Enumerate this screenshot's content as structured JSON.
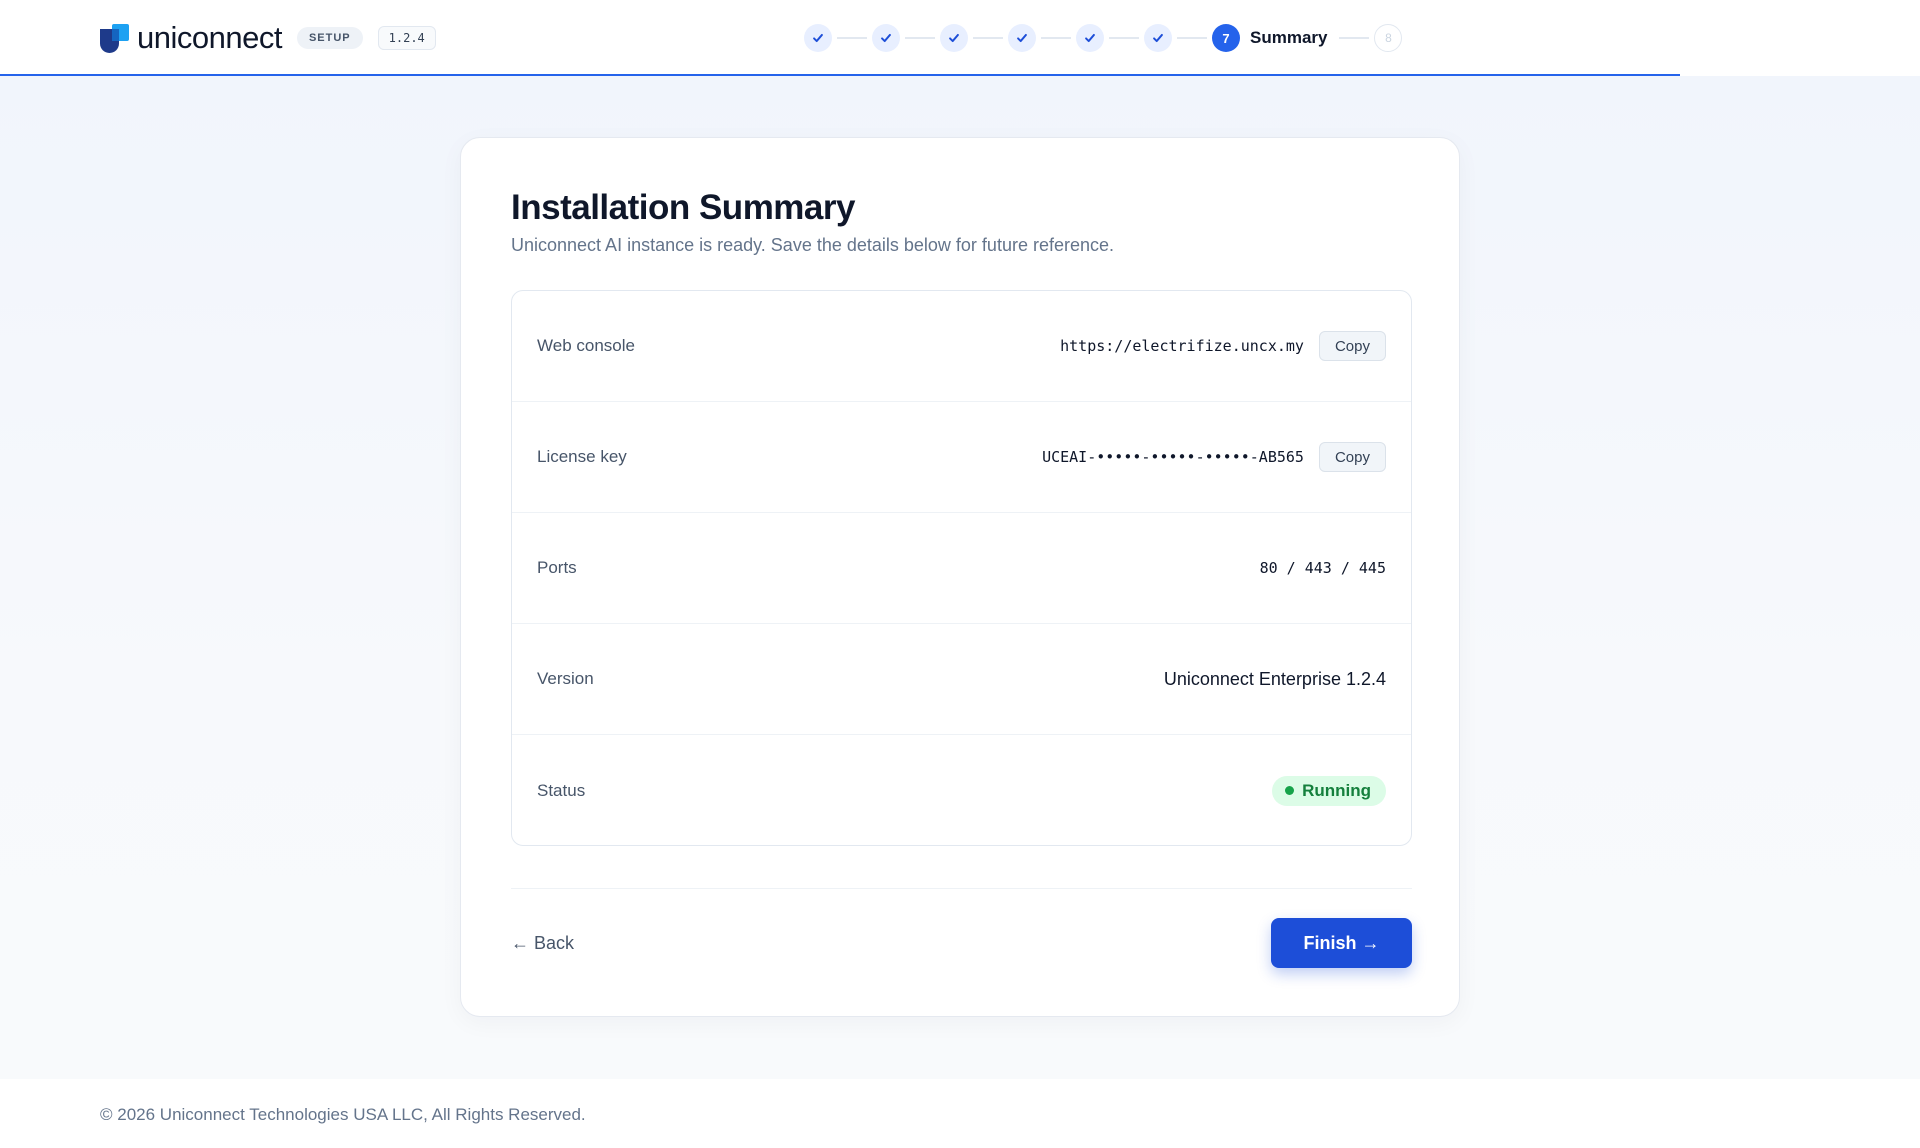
{
  "header": {
    "brand": "uniconnect",
    "setup_pill": "SETUP",
    "version_chip": "1.2.4",
    "steps": [
      {
        "state": "done"
      },
      {
        "state": "done"
      },
      {
        "state": "done"
      },
      {
        "state": "done"
      },
      {
        "state": "done"
      },
      {
        "state": "done"
      },
      {
        "state": "active",
        "number": "7",
        "label": "Summary"
      },
      {
        "state": "future",
        "number": "8"
      }
    ]
  },
  "main": {
    "title": "Installation Summary",
    "subtitle": "Uniconnect AI instance is ready. Save the details below for future reference.",
    "details": {
      "web_console": {
        "label": "Web console",
        "value": "https://electrifize.uncx.my",
        "copy_label": "Copy"
      },
      "license_key": {
        "label": "License key",
        "value": "UCEAI-•••••-•••••-•••••-AB565",
        "copy_label": "Copy"
      },
      "ports": {
        "label": "Ports",
        "value": "80 / 443 / 445"
      },
      "version": {
        "label": "Version",
        "value": "Uniconnect Enterprise 1.2.4"
      },
      "status": {
        "label": "Status",
        "value": "Running",
        "color": "#16a34a"
      }
    },
    "back_label": "← Back",
    "finish_label": "Finish →"
  },
  "footer": {
    "copyright": "© 2026 Uniconnect Technologies USA LLC, All Rights Reserved."
  },
  "colors": {
    "accent": "#2563eb",
    "primary_button": "#1d4ed8",
    "success": "#16a34a"
  }
}
